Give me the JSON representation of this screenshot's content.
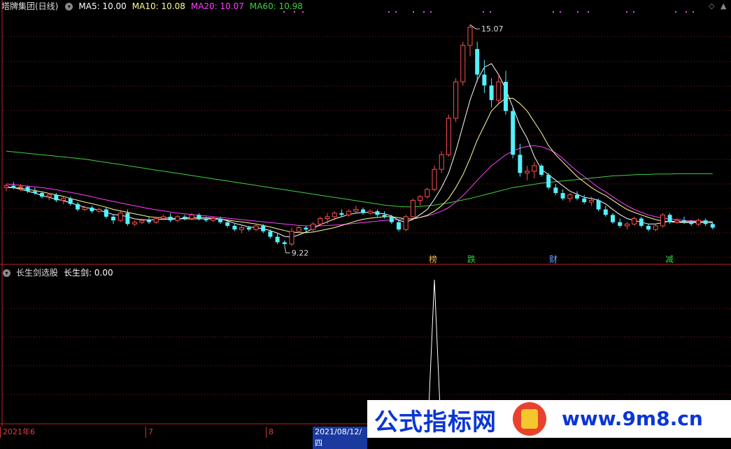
{
  "main_header": {
    "stock": "塔牌集团(日线)",
    "ma5": "MA5: 10.00",
    "ma10": "MA10: 10.08",
    "ma20": "MA20: 10.07",
    "ma60": "MA60: 10.98"
  },
  "indicator_header": {
    "name": "长生剑选股",
    "value": "长生剑: 0.00"
  },
  "high_label": "15.07",
  "low_label": "9.22",
  "event_tags": [
    {
      "text": "榜",
      "color": "#e6b84a"
    },
    {
      "text": "跌",
      "color": "#30d040"
    },
    {
      "text": "财",
      "color": "#6aa6ff"
    },
    {
      "text": "减",
      "color": "#30d040"
    }
  ],
  "date_bar": {
    "d1": "2021年6",
    "d2": "7",
    "d3": "8",
    "d4": "2021/08/12/四"
  },
  "watermark": {
    "cn": "公式指标网",
    "url": "www.9m8.cn"
  },
  "colors": {
    "up": "#ff5050",
    "down": "#54f0ff",
    "ma5": "#ffffff",
    "ma10": "#ffff99",
    "ma20": "#ff40ff",
    "ma60": "#40d040",
    "grid": "#802020"
  },
  "chart_data": {
    "type": "candlestick",
    "price_range": [
      8.8,
      15.4
    ],
    "candles": [
      [
        10.6,
        10.7,
        10.5,
        10.65
      ],
      [
        10.65,
        10.75,
        10.55,
        10.6
      ],
      [
        10.6,
        10.7,
        10.5,
        10.62
      ],
      [
        10.62,
        10.65,
        10.45,
        10.5
      ],
      [
        10.5,
        10.6,
        10.4,
        10.45
      ],
      [
        10.45,
        10.5,
        10.3,
        10.35
      ],
      [
        10.35,
        10.45,
        10.25,
        10.4
      ],
      [
        10.4,
        10.45,
        10.2,
        10.25
      ],
      [
        10.25,
        10.35,
        10.15,
        10.3
      ],
      [
        10.3,
        10.35,
        10.1,
        10.15
      ],
      [
        10.15,
        10.2,
        9.95,
        10.0
      ],
      [
        10.0,
        10.1,
        9.95,
        10.05
      ],
      [
        10.05,
        10.1,
        9.9,
        9.95
      ],
      [
        9.95,
        10.05,
        9.9,
        10.0
      ],
      [
        10.0,
        10.05,
        9.75,
        9.8
      ],
      [
        9.8,
        9.85,
        9.6,
        9.7
      ],
      [
        9.7,
        9.95,
        9.65,
        9.9
      ],
      [
        9.9,
        10.0,
        9.55,
        9.6
      ],
      [
        9.6,
        9.7,
        9.55,
        9.65
      ],
      [
        9.65,
        9.75,
        9.6,
        9.7
      ],
      [
        9.7,
        9.8,
        9.6,
        9.65
      ],
      [
        9.65,
        9.8,
        9.6,
        9.75
      ],
      [
        9.75,
        9.85,
        9.7,
        9.8
      ],
      [
        9.8,
        9.9,
        9.65,
        9.7
      ],
      [
        9.7,
        9.85,
        9.65,
        9.8
      ],
      [
        9.8,
        9.85,
        9.7,
        9.75
      ],
      [
        9.75,
        9.9,
        9.7,
        9.85
      ],
      [
        9.85,
        9.9,
        9.7,
        9.75
      ],
      [
        9.75,
        9.8,
        9.65,
        9.7
      ],
      [
        9.7,
        9.8,
        9.65,
        9.75
      ],
      [
        9.75,
        9.8,
        9.6,
        9.65
      ],
      [
        9.65,
        9.7,
        9.5,
        9.55
      ],
      [
        9.55,
        9.6,
        9.4,
        9.45
      ],
      [
        9.45,
        9.55,
        9.35,
        9.5
      ],
      [
        9.5,
        9.55,
        9.4,
        9.45
      ],
      [
        9.45,
        9.6,
        9.4,
        9.55
      ],
      [
        9.55,
        9.6,
        9.35,
        9.4
      ],
      [
        9.4,
        9.45,
        9.2,
        9.25
      ],
      [
        9.25,
        9.35,
        9.05,
        9.1
      ],
      [
        9.1,
        9.15,
        9.0,
        9.05
      ],
      [
        9.05,
        9.5,
        9.0,
        9.4
      ],
      [
        9.4,
        9.55,
        9.35,
        9.5
      ],
      [
        9.5,
        9.55,
        9.35,
        9.45
      ],
      [
        9.45,
        9.65,
        9.4,
        9.6
      ],
      [
        9.6,
        9.8,
        9.55,
        9.75
      ],
      [
        9.75,
        9.9,
        9.6,
        9.8
      ],
      [
        9.8,
        9.95,
        9.7,
        9.9
      ],
      [
        9.9,
        10.0,
        9.8,
        9.85
      ],
      [
        9.85,
        10.0,
        9.8,
        9.95
      ],
      [
        9.95,
        10.1,
        9.9,
        10.0
      ],
      [
        10.0,
        10.05,
        9.85,
        9.9
      ],
      [
        9.9,
        10.0,
        9.85,
        9.95
      ],
      [
        9.95,
        10.0,
        9.8,
        9.85
      ],
      [
        9.85,
        9.95,
        9.75,
        9.8
      ],
      [
        9.8,
        9.85,
        9.6,
        9.65
      ],
      [
        9.65,
        9.7,
        9.4,
        9.45
      ],
      [
        9.45,
        9.85,
        9.4,
        9.8
      ],
      [
        9.8,
        10.3,
        9.75,
        10.25
      ],
      [
        10.25,
        10.4,
        10.1,
        10.35
      ],
      [
        10.35,
        10.6,
        10.3,
        10.55
      ],
      [
        10.55,
        11.2,
        10.5,
        11.1
      ],
      [
        11.1,
        11.6,
        11.0,
        11.5
      ],
      [
        11.5,
        12.6,
        11.45,
        12.5
      ],
      [
        12.5,
        13.6,
        12.4,
        13.5
      ],
      [
        13.5,
        14.6,
        13.4,
        14.5
      ],
      [
        14.5,
        15.07,
        14.2,
        15.0
      ],
      [
        14.4,
        14.6,
        13.5,
        13.7
      ],
      [
        13.7,
        14.1,
        13.2,
        13.4
      ],
      [
        13.4,
        13.6,
        12.8,
        13.0
      ],
      [
        13.0,
        13.7,
        12.9,
        13.5
      ],
      [
        13.5,
        13.8,
        12.6,
        12.7
      ],
      [
        12.7,
        12.8,
        11.4,
        11.5
      ],
      [
        11.5,
        11.8,
        10.9,
        11.0
      ],
      [
        11.0,
        11.2,
        10.8,
        11.05
      ],
      [
        11.05,
        11.3,
        10.85,
        11.2
      ],
      [
        11.2,
        11.25,
        10.9,
        10.95
      ],
      [
        10.95,
        11.0,
        10.55,
        10.6
      ],
      [
        10.6,
        10.7,
        10.4,
        10.45
      ],
      [
        10.45,
        10.55,
        10.25,
        10.3
      ],
      [
        10.3,
        10.45,
        10.2,
        10.4
      ],
      [
        10.4,
        10.5,
        10.25,
        10.3
      ],
      [
        10.3,
        10.4,
        10.15,
        10.2
      ],
      [
        10.2,
        10.35,
        10.1,
        10.25
      ],
      [
        10.25,
        10.3,
        9.95,
        10.0
      ],
      [
        10.0,
        10.1,
        9.8,
        9.85
      ],
      [
        9.85,
        9.9,
        9.6,
        9.65
      ],
      [
        9.65,
        9.75,
        9.5,
        9.55
      ],
      [
        9.55,
        9.65,
        9.45,
        9.6
      ],
      [
        9.6,
        9.8,
        9.55,
        9.75
      ],
      [
        9.75,
        9.8,
        9.5,
        9.55
      ],
      [
        9.55,
        9.6,
        9.4,
        9.45
      ],
      [
        9.45,
        9.6,
        9.4,
        9.55
      ],
      [
        9.55,
        9.9,
        9.5,
        9.85
      ],
      [
        9.85,
        9.9,
        9.6,
        9.65
      ],
      [
        9.65,
        9.75,
        9.6,
        9.7
      ],
      [
        9.7,
        9.8,
        9.6,
        9.65
      ],
      [
        9.65,
        9.7,
        9.55,
        9.6
      ],
      [
        9.6,
        9.75,
        9.55,
        9.7
      ],
      [
        9.7,
        9.75,
        9.55,
        9.6
      ],
      [
        9.6,
        9.65,
        9.45,
        9.5
      ]
    ],
    "ma5": [
      10.62,
      10.6,
      10.55,
      10.5,
      10.45,
      10.38,
      10.33,
      10.28,
      10.24,
      10.18,
      10.12,
      10.06,
      10.02,
      9.98,
      9.92,
      9.86,
      9.84,
      9.8,
      9.74,
      9.72,
      9.71,
      9.72,
      9.73,
      9.73,
      9.74,
      9.76,
      9.78,
      9.78,
      9.77,
      9.76,
      9.74,
      9.69,
      9.62,
      9.57,
      9.52,
      9.5,
      9.47,
      9.42,
      9.35,
      9.26,
      9.24,
      9.3,
      9.38,
      9.48,
      9.58,
      9.66,
      9.74,
      9.8,
      9.86,
      9.9,
      9.92,
      9.92,
      9.9,
      9.88,
      9.82,
      9.7,
      9.65,
      9.73,
      9.86,
      10.0,
      10.28,
      10.6,
      11.0,
      11.6,
      12.3,
      13.0,
      13.55,
      13.9,
      14.0,
      13.7,
      13.3,
      12.8,
      12.3,
      11.95,
      11.45,
      11.1,
      10.95,
      10.8,
      10.65,
      10.5,
      10.42,
      10.33,
      10.3,
      10.25,
      10.15,
      10.0,
      9.86,
      9.75,
      9.7,
      9.65,
      9.6,
      9.6,
      9.64,
      9.68,
      9.67,
      9.66,
      9.67,
      9.66,
      9.65,
      9.63
    ],
    "ma10": [
      10.6,
      10.6,
      10.58,
      10.55,
      10.52,
      10.48,
      10.44,
      10.4,
      10.36,
      10.3,
      10.25,
      10.2,
      10.16,
      10.11,
      10.06,
      10.0,
      9.96,
      9.92,
      9.88,
      9.84,
      9.8,
      9.78,
      9.77,
      9.76,
      9.75,
      9.74,
      9.74,
      9.74,
      9.74,
      9.74,
      9.73,
      9.71,
      9.68,
      9.66,
      9.63,
      9.6,
      9.56,
      9.52,
      9.47,
      9.42,
      9.38,
      9.36,
      9.36,
      9.38,
      9.42,
      9.46,
      9.5,
      9.56,
      9.62,
      9.68,
      9.73,
      9.76,
      9.78,
      9.8,
      9.8,
      9.77,
      9.74,
      9.74,
      9.78,
      9.84,
      9.95,
      10.1,
      10.3,
      10.6,
      10.95,
      11.4,
      11.9,
      12.3,
      12.7,
      12.9,
      13.05,
      13.05,
      12.9,
      12.7,
      12.4,
      12.1,
      11.75,
      11.5,
      11.3,
      11.1,
      10.9,
      10.75,
      10.6,
      10.48,
      10.38,
      10.25,
      10.12,
      10.0,
      9.92,
      9.85,
      9.78,
      9.72,
      9.68,
      9.66,
      9.65,
      9.64,
      9.64,
      9.64,
      9.65,
      9.64
    ],
    "ma20": [
      10.7,
      10.68,
      10.66,
      10.64,
      10.62,
      10.6,
      10.57,
      10.54,
      10.5,
      10.47,
      10.43,
      10.39,
      10.35,
      10.3,
      10.26,
      10.22,
      10.18,
      10.14,
      10.1,
      10.06,
      10.02,
      9.99,
      9.96,
      9.93,
      9.9,
      9.88,
      9.86,
      9.84,
      9.82,
      9.8,
      9.78,
      9.76,
      9.74,
      9.72,
      9.7,
      9.68,
      9.66,
      9.64,
      9.62,
      9.6,
      9.58,
      9.56,
      9.55,
      9.55,
      9.55,
      9.56,
      9.57,
      9.58,
      9.6,
      9.62,
      9.64,
      9.66,
      9.68,
      9.7,
      9.71,
      9.72,
      9.73,
      9.75,
      9.78,
      9.82,
      9.88,
      9.95,
      10.05,
      10.2,
      10.38,
      10.58,
      10.8,
      11.0,
      11.2,
      11.35,
      11.5,
      11.6,
      11.68,
      11.73,
      11.75,
      11.72,
      11.65,
      11.55,
      11.4,
      11.22,
      11.05,
      10.9,
      10.75,
      10.6,
      10.48,
      10.35,
      10.22,
      10.1,
      10.0,
      9.92,
      9.85,
      9.8,
      9.76,
      9.74,
      9.72,
      9.7,
      9.69,
      9.68,
      9.68,
      9.67
    ],
    "ma60": [
      11.6,
      11.58,
      11.56,
      11.54,
      11.52,
      11.5,
      11.48,
      11.46,
      11.44,
      11.42,
      11.4,
      11.38,
      11.35,
      11.32,
      11.29,
      11.26,
      11.23,
      11.2,
      11.17,
      11.14,
      11.11,
      11.08,
      11.05,
      11.02,
      10.99,
      10.96,
      10.93,
      10.9,
      10.87,
      10.84,
      10.81,
      10.78,
      10.75,
      10.72,
      10.69,
      10.66,
      10.63,
      10.6,
      10.57,
      10.54,
      10.51,
      10.48,
      10.45,
      10.42,
      10.39,
      10.36,
      10.33,
      10.3,
      10.27,
      10.24,
      10.21,
      10.18,
      10.15,
      10.12,
      10.1,
      10.08,
      10.07,
      10.07,
      10.08,
      10.1,
      10.12,
      10.15,
      10.18,
      10.22,
      10.26,
      10.3,
      10.35,
      10.4,
      10.45,
      10.5,
      10.55,
      10.6,
      10.63,
      10.66,
      10.69,
      10.72,
      10.74,
      10.76,
      10.78,
      10.8,
      10.82,
      10.84,
      10.86,
      10.88,
      10.9,
      10.92,
      10.93,
      10.94,
      10.95,
      10.96,
      10.96,
      10.97,
      10.97,
      10.97,
      10.98,
      10.98,
      10.98,
      10.98,
      10.98,
      10.98
    ],
    "indicator": {
      "name": "长生剑",
      "range": [
        0,
        1
      ],
      "spike_at": 60,
      "spike_value": 1.0
    }
  }
}
